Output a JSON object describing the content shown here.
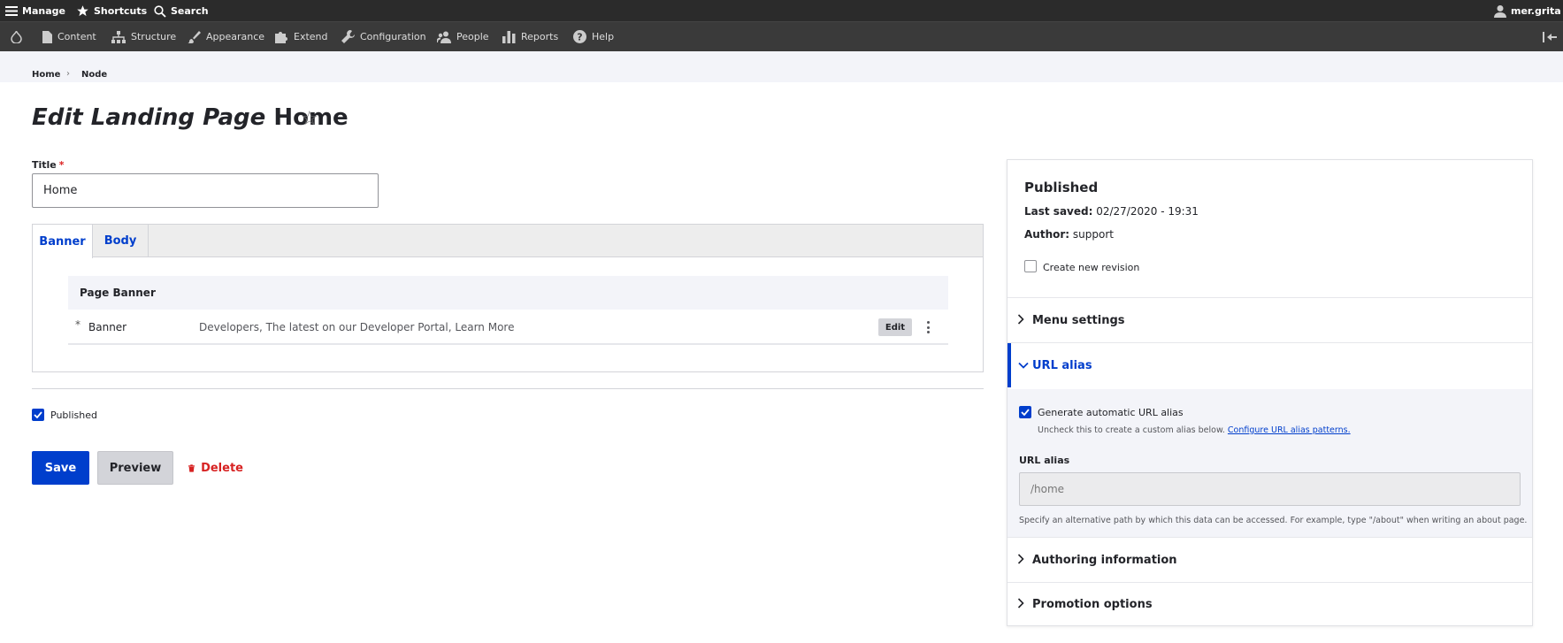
{
  "toolbar": {
    "manage": "Manage",
    "shortcuts": "Shortcuts",
    "search": "Search",
    "user": "mer.grita"
  },
  "tray": {
    "items": [
      "Content",
      "Structure",
      "Appearance",
      "Extend",
      "Configuration",
      "People",
      "Reports",
      "Help"
    ]
  },
  "breadcrumb": {
    "items": [
      "Home",
      "Node"
    ],
    "separator": "›"
  },
  "page": {
    "title_italic": "Edit Landing Page",
    "title_plain": "Home",
    "star": "☆"
  },
  "form": {
    "title_label": "Title",
    "required_mark": "*",
    "title_value": "Home",
    "tabs": [
      "Banner",
      "Body"
    ],
    "page_banner": {
      "heading": "Page Banner",
      "row": {
        "marker": "*",
        "name": "Banner",
        "description": "Developers, The latest on our Developer Portal, Learn More",
        "edit_label": "Edit"
      }
    },
    "published_label": "Published",
    "published_checked": true,
    "save_label": "Save",
    "preview_label": "Preview",
    "delete_label": "Delete"
  },
  "sidebar": {
    "status": "Published",
    "last_saved_label": "Last saved:",
    "last_saved_value": "02/27/2020 - 19:31",
    "author_label": "Author:",
    "author_value": "support",
    "new_revision_label": "Create new revision",
    "new_revision_checked": false,
    "sections": {
      "menu": "Menu settings",
      "url_alias": "URL alias",
      "authoring": "Authoring information",
      "promotion": "Promotion options"
    },
    "url_alias_body": {
      "auto_label": "Generate automatic URL alias",
      "auto_checked": true,
      "auto_help": "Uncheck this to create a custom alias below.",
      "auto_help_link": "Configure URL alias patterns.",
      "field_label": "URL alias",
      "field_value": "/home",
      "field_help": "Specify an alternative path by which this data can be accessed. For example, type \"/about\" when writing an about page."
    }
  },
  "colors": {
    "primary": "#003ecc",
    "danger": "#d72222",
    "toolbar_bg": "#2b2b2b",
    "tray_bg": "#3a3a3a"
  }
}
